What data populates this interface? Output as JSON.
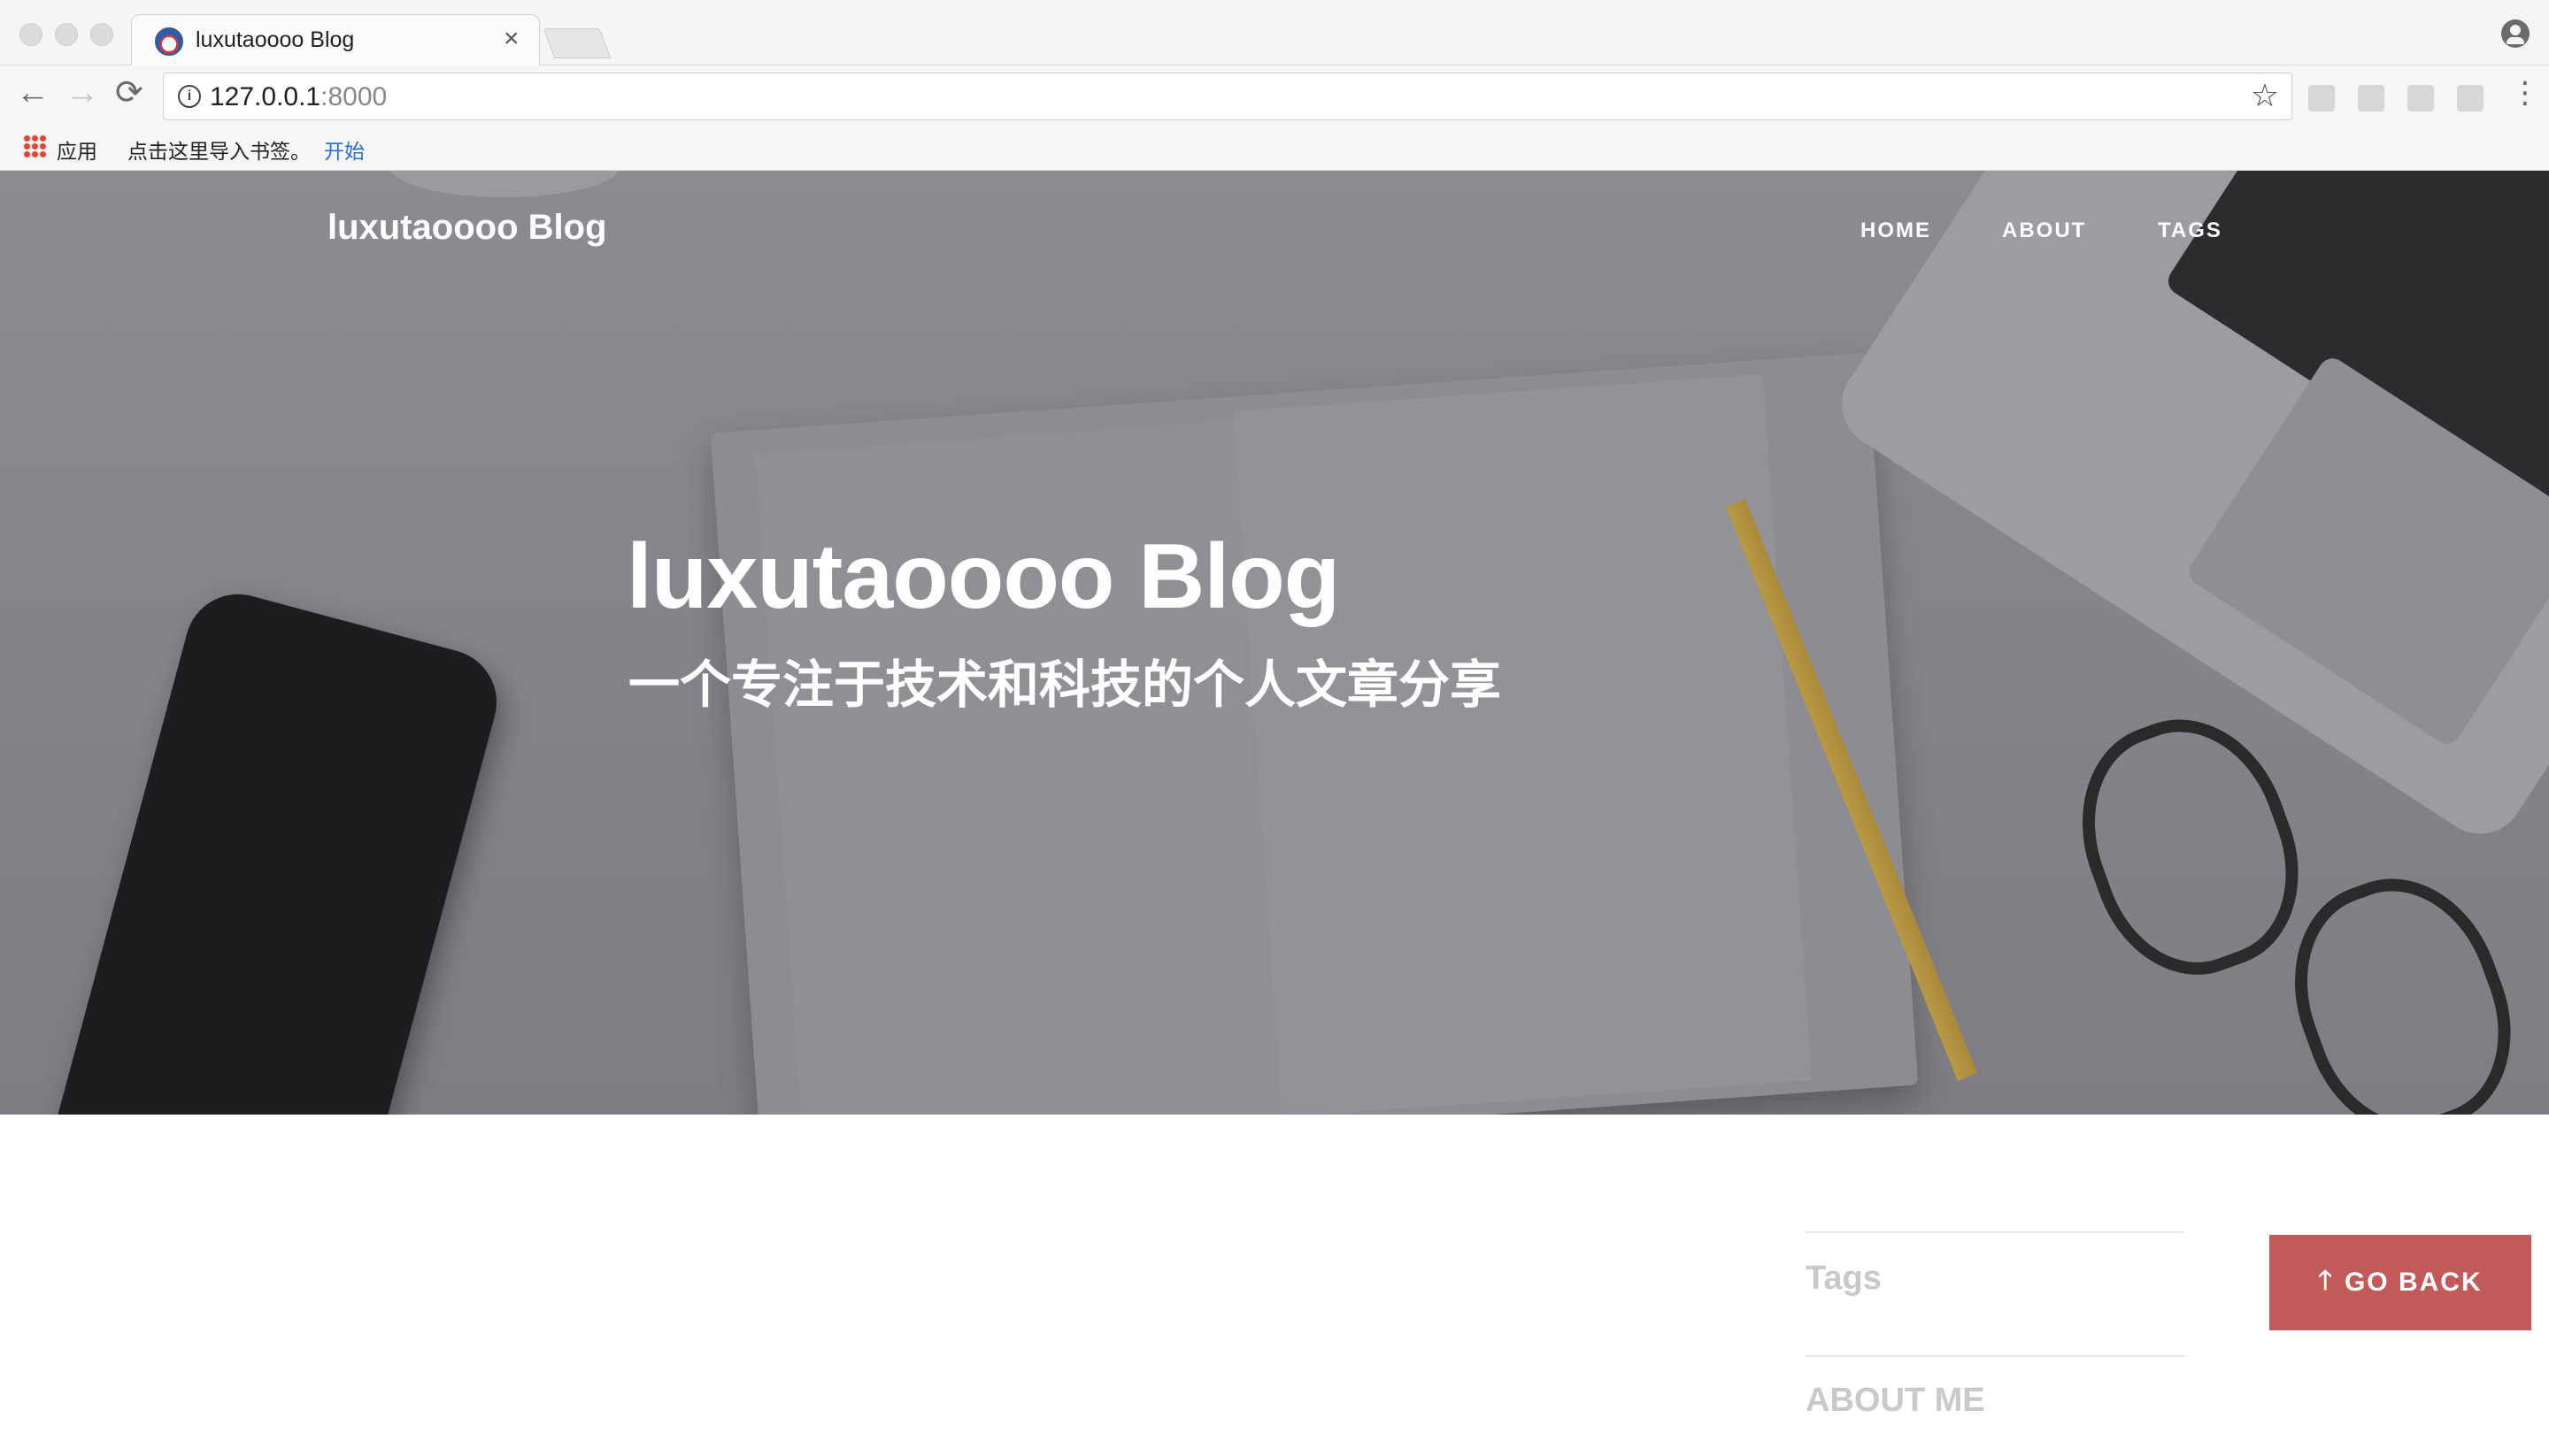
{
  "browser": {
    "tab_title": "luxutaoooo Blog",
    "tab_close": "×",
    "url_host": "127.0.0.1",
    "url_port": ":8000",
    "back_glyph": "←",
    "forward_glyph": "→",
    "reload_glyph": "⟳",
    "star_glyph": "☆",
    "menu_glyph": "⋮",
    "info_glyph": "i"
  },
  "bookmarks": {
    "apps_label": "应用",
    "import_text": "点击这里导入书签。",
    "start_link": "开始"
  },
  "site": {
    "brand": "luxutaoooo Blog",
    "nav": [
      "HOME",
      "ABOUT",
      "TAGS"
    ],
    "hero_title": "luxutaoooo Blog",
    "hero_subtitle": "一个专注于技术和科技的个人文章分享"
  },
  "sidebar": {
    "tags_heading": "Tags",
    "about_heading": "ABOUT ME"
  },
  "go_back": {
    "arrow": "🡑",
    "label": "GO BACK"
  },
  "colors": {
    "go_back_bg": "#c35a5a",
    "hero_overlay": "#7d7d83"
  }
}
